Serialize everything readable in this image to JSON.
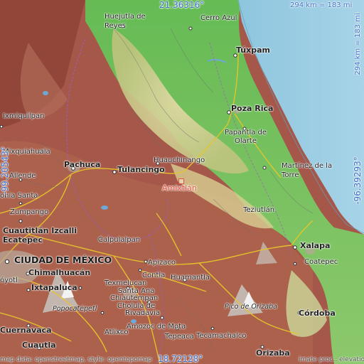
{
  "map": {
    "colors": {
      "sea": "#9fcfe4",
      "lowland": "#5cb84a",
      "upland": "#d7cf95",
      "mountain": "#9c4c3e",
      "target": "#e8543e",
      "coord_text": "#3b6fc8",
      "road": "#e6c52a"
    },
    "coordinates": {
      "north": "21.36316°",
      "south": "18.72128°",
      "west": "-99.20543°",
      "east": "-96.39293°",
      "scale_horizontal": "294 km = 183 mi",
      "scale_vertical": "294 km = 183 mi"
    },
    "target": {
      "name": "Amixtlán"
    },
    "places": {
      "huejutla": "Huejutla de\nReyes",
      "cerro_azul": "Cerro Azul",
      "tuxpam": "Túxpam",
      "poza_rica": "Poza Rica",
      "papantla": "Papantla de\nOlarte",
      "ixmiquilpan": "Ixmiquilpan",
      "mixquiahuala": "Mixquiahuala",
      "pachuca": "Pachuca",
      "tulancingo": "Tulancingo",
      "huauchinango": "Huauchinango",
      "martinez": "Martínez de la\nTorre",
      "allende": "Allende",
      "tonia_santa": "onia Santa",
      "zumpango": "Zumpango",
      "teziutlan": "Teziutlán",
      "cuautitlan": "Cuautitlán Izcalli",
      "ecatepec": "Ecatepec",
      "calpulalpan": "Calpulalpan",
      "xalapa": "Xalapa",
      "coatepec": "Coatepec",
      "cdmx": "CIUDAD DE MÉXICO",
      "chimalhuacan": "Chimalhuacán",
      "apizaco": "Apizaco",
      "coyotl": "óyotl",
      "ixtapaluca": "Ixtapaluca",
      "contla": "Contla",
      "huamantla": "Huamantla",
      "texmelucan": "Texmelucan",
      "santa_ana": "Santa Ana",
      "chiautempan": "Chiautempan",
      "cholula": "Cholula de",
      "rivadavia": "Rivadavia",
      "popocatepetl": "Popocatépetl",
      "pico_orizaba": "Pico de Orizaba",
      "cuernavaca": "Cuernavaca",
      "atlixco": "Atlixco",
      "amozoc": "Amozoc de Mota",
      "tepeaca": "Tepeaca",
      "tecamachalco": "Tecamachalco",
      "cordoba": "Córdoba",
      "cuautla": "Cuautla",
      "orizaba": "Orizaba"
    },
    "attribution_left": "map data: openstreetmap, style: opentopomap",
    "attribution_right": "imate proc.: elevation.city"
  }
}
